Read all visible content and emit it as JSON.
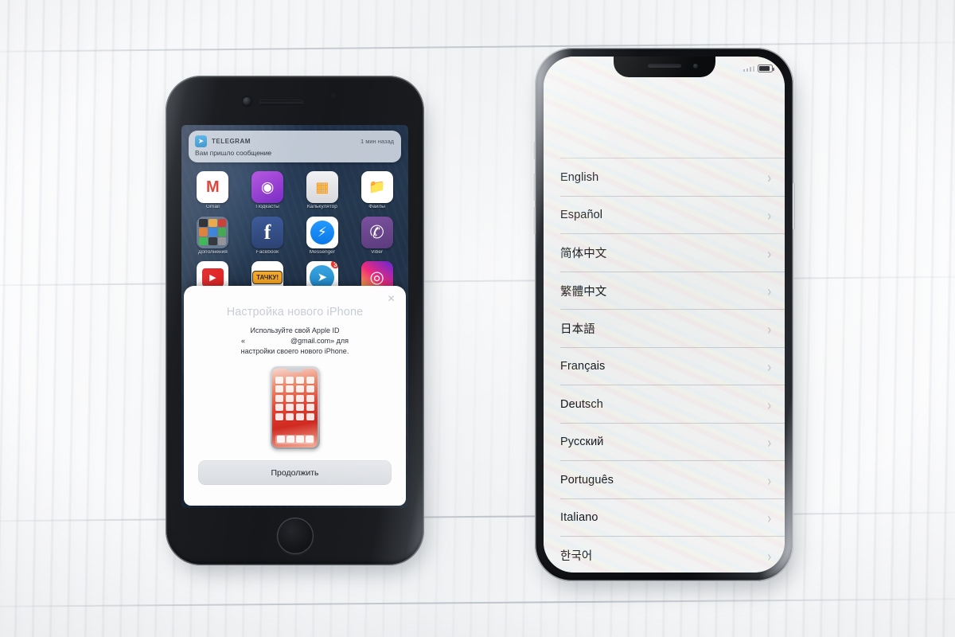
{
  "scene": {
    "description": "Two iPhones lying on a white painted wooden surface",
    "background_color": "#f4f5f6"
  },
  "left_phone": {
    "model_style": "iphone-8-space-gray",
    "notification": {
      "app_name": "TELEGRAM",
      "time": "1 мин назад",
      "body": "Вам пришло сообщение",
      "icon": "telegram-icon"
    },
    "home_screen": {
      "apps": [
        {
          "label": "Gmail",
          "icon": "gmail-icon",
          "badge": ""
        },
        {
          "label": "Подкасты",
          "icon": "podcasts-icon",
          "badge": ""
        },
        {
          "label": "Калькулятор",
          "icon": "calculator-icon",
          "badge": ""
        },
        {
          "label": "Файлы",
          "icon": "files-icon",
          "badge": ""
        },
        {
          "label": "Дополнения",
          "icon": "folder-icon",
          "badge": ""
        },
        {
          "label": "Facebook",
          "icon": "facebook-icon",
          "badge": ""
        },
        {
          "label": "Messenger",
          "icon": "messenger-icon",
          "badge": ""
        },
        {
          "label": "Viber",
          "icon": "viber-icon",
          "badge": ""
        },
        {
          "label": "",
          "icon": "youtube-icon",
          "badge": ""
        },
        {
          "label": "",
          "icon": "tachku-icon",
          "badge": ""
        },
        {
          "label": "",
          "icon": "telegram-icon",
          "badge": "3"
        },
        {
          "label": "",
          "icon": "instagram-icon",
          "badge": ""
        }
      ]
    },
    "setup_dialog": {
      "title": "Настройка нового iPhone",
      "body_line1": "Используйте свой Apple ID",
      "body_line2_prefix": "«",
      "body_line2_email_redacted": "",
      "body_line2_suffix": "@gmail.com» для",
      "body_line3": "настройки своего нового iPhone.",
      "illustration": "iphone-x-device-illustration",
      "close_icon": "close-icon",
      "continue_label": "Продолжить"
    }
  },
  "right_phone": {
    "model_style": "iphone-x-silver",
    "status_bar": {
      "signal_icon": "signal-bars-icon",
      "battery_icon": "battery-icon"
    },
    "language_screen": {
      "languages": [
        {
          "name": "English",
          "chevron": "›"
        },
        {
          "name": "Español",
          "chevron": "›"
        },
        {
          "name": "简体中文",
          "chevron": "›"
        },
        {
          "name": "繁體中文",
          "chevron": "›"
        },
        {
          "name": "日本語",
          "chevron": "›"
        },
        {
          "name": "Français",
          "chevron": "›"
        },
        {
          "name": "Deutsch",
          "chevron": "›"
        },
        {
          "name": "Русский",
          "chevron": "›"
        },
        {
          "name": "Português",
          "chevron": "›"
        },
        {
          "name": "Italiano",
          "chevron": "›"
        },
        {
          "name": "한국어",
          "chevron": "›"
        }
      ]
    }
  }
}
